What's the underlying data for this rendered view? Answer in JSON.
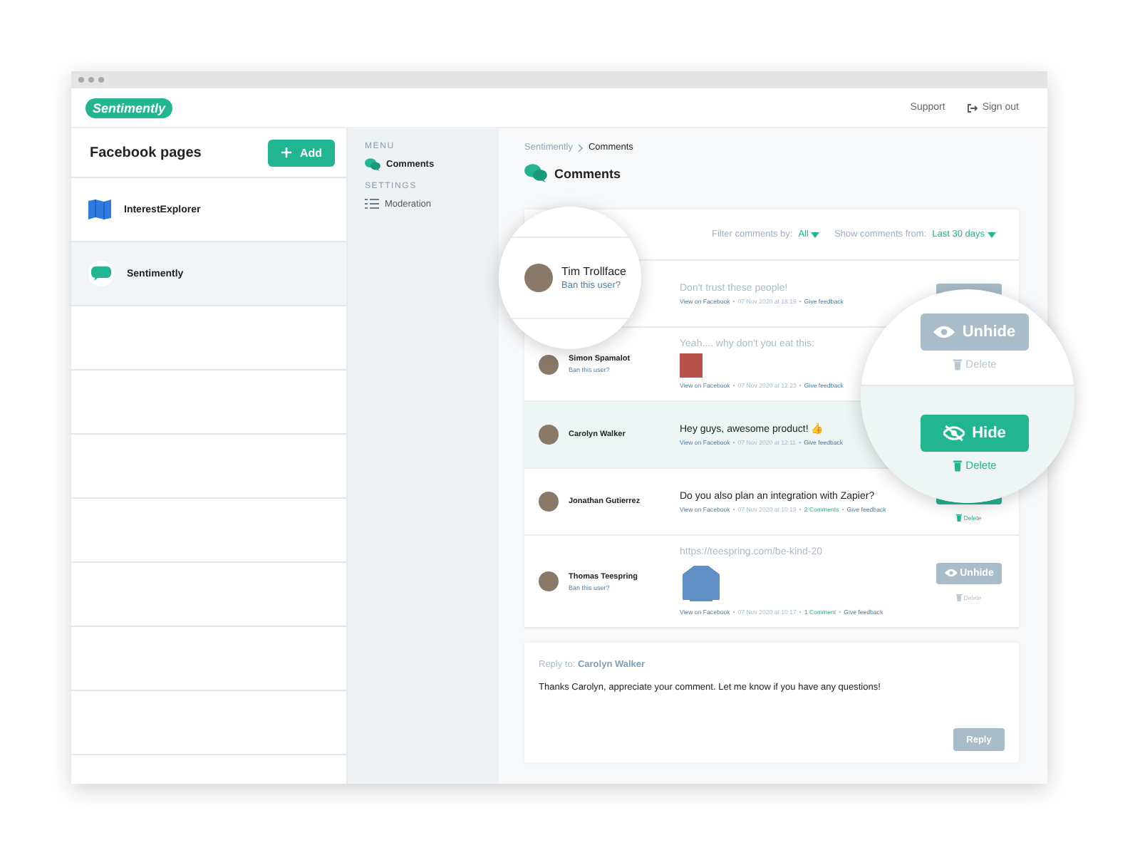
{
  "window": {
    "logo": "Sentimently",
    "links": [
      {
        "label": "Support",
        "kind": "plain"
      },
      {
        "label": "Sign out",
        "kind": "signout"
      }
    ]
  },
  "pages_panel": {
    "title": "Facebook pages",
    "add_button": "Add",
    "pages": [
      {
        "name": "InterestExplorer",
        "kind": "map",
        "selected": false
      },
      {
        "name": "Sentimently",
        "kind": "chat",
        "selected": true
      }
    ]
  },
  "menu": [
    {
      "heading": "MENU",
      "items": [
        {
          "label": "Comments",
          "kind": "comments",
          "selected": true
        }
      ]
    },
    {
      "heading": "SETTINGS",
      "items": [
        {
          "label": "Moderation",
          "kind": "list",
          "selected": false
        }
      ]
    }
  ],
  "breadcrumb": [
    "Sentimently",
    "Comments"
  ],
  "page_title": "Comments",
  "filters": {
    "filter_label": "Filter comments by:",
    "filter_value": "All",
    "range_label": "Show comments from:",
    "range_value": "Last 30 days"
  },
  "comments": [
    {
      "text": "Don't trust these people!",
      "hidden": true,
      "selected": false,
      "meta": [
        {
          "kind": "link",
          "text": "View on Facebook"
        },
        {
          "kind": "sep",
          "text": "•"
        },
        {
          "kind": "date",
          "text": "07 Nov 2020 at 18:19"
        },
        {
          "kind": "sep",
          "text": "•"
        },
        {
          "kind": "link",
          "text": "Give feedback"
        }
      ],
      "action": {
        "kind": "unhide"
      }
    },
    {
      "user": {
        "name": "Simon Spamalot",
        "ban": "Ban this user?"
      },
      "text": "Yeah.... why don't you eat this:",
      "hidden": true,
      "selected": false,
      "attachment": {
        "kind": "photo"
      },
      "meta": [
        {
          "kind": "link",
          "text": "View on Facebook"
        },
        {
          "kind": "sep",
          "text": "•"
        },
        {
          "kind": "date",
          "text": "07 Nov 2020 at 12:23"
        },
        {
          "kind": "sep",
          "text": "•"
        },
        {
          "kind": "link",
          "text": "Give feedback"
        }
      ]
    },
    {
      "user": {
        "name": "Carolyn Walker"
      },
      "text": "Hey guys, awesome product! 👍",
      "hidden": false,
      "selected": true,
      "meta": [
        {
          "kind": "link",
          "text": "View on Facebook"
        },
        {
          "kind": "sep",
          "text": "•"
        },
        {
          "kind": "date",
          "text": "07 Nov 2020 at 12:11"
        },
        {
          "kind": "sep",
          "text": "•"
        },
        {
          "kind": "link",
          "text": "Give feedback"
        }
      ]
    },
    {
      "user": {
        "name": "Jonathan Gutierrez"
      },
      "text": "Do you also plan an integration with Zapier?",
      "hidden": false,
      "selected": false,
      "meta": [
        {
          "kind": "link",
          "text": "View on Facebook"
        },
        {
          "kind": "sep",
          "text": "•"
        },
        {
          "kind": "date",
          "text": "07 Nov 2020 at 10:19"
        },
        {
          "kind": "sep",
          "text": "•"
        },
        {
          "kind": "count",
          "text": "2 Comments"
        },
        {
          "kind": "sep",
          "text": "•"
        },
        {
          "kind": "link",
          "text": "Give feedback"
        }
      ],
      "action": {
        "kind": "hide",
        "delete": "Delete"
      }
    },
    {
      "user": {
        "name": "Thomas Teespring",
        "ban": "Ban this user?"
      },
      "text": "https://teespring.com/be-kind-20",
      "hidden": true,
      "selected": false,
      "attachment": {
        "kind": "garment"
      },
      "meta": [
        {
          "kind": "link",
          "text": "View on Facebook"
        },
        {
          "kind": "sep",
          "text": "•"
        },
        {
          "kind": "date",
          "text": "07 Nov 2020 at 10:17"
        },
        {
          "kind": "sep",
          "text": "•"
        },
        {
          "kind": "count",
          "text": "1 Comment"
        },
        {
          "kind": "sep",
          "text": "•"
        },
        {
          "kind": "link",
          "text": "Give feedback"
        }
      ],
      "action": {
        "kind": "unhide",
        "label": "Unhide",
        "delete": "Delete"
      }
    }
  ],
  "user_magnifier": {
    "name": "Tim Trollface",
    "ban": "Ban this user?"
  },
  "action_magnifier": [
    {
      "kind": "unhide",
      "label": "Unhide",
      "delete": "Delete",
      "selected": false
    },
    {
      "kind": "hide",
      "label": "Hide",
      "delete": "Delete",
      "selected": true
    }
  ],
  "reply": {
    "label": "Reply to:",
    "name": "Carolyn Walker",
    "text": "Thanks Carolyn, appreciate your comment. Let me know if you have any questions!",
    "button": "Reply"
  }
}
